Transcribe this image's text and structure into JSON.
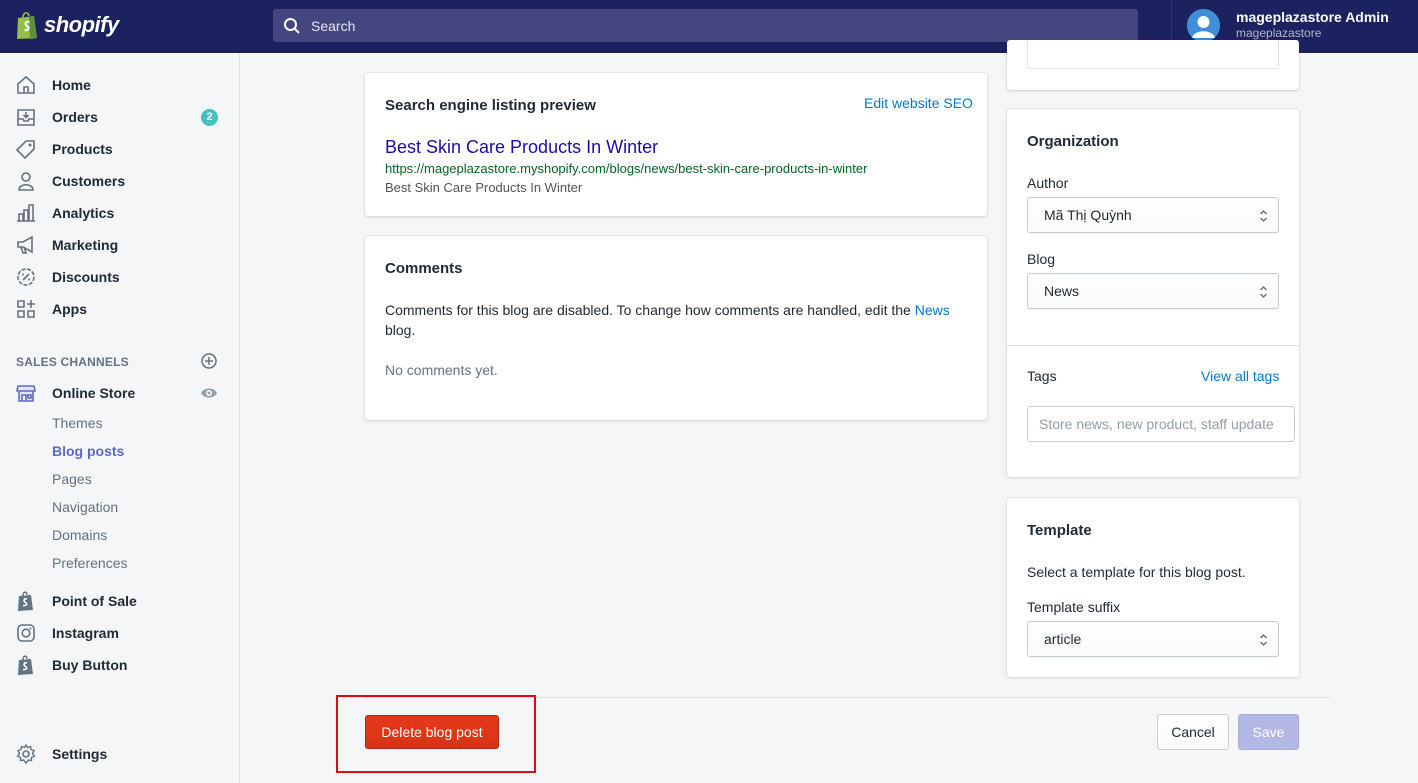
{
  "header": {
    "logo_text": "shopify",
    "search_placeholder": "Search",
    "user_name": "mageplazastore Admin",
    "user_store": "mageplazastore"
  },
  "sidebar": {
    "items": [
      {
        "label": "Home",
        "icon": "home-icon"
      },
      {
        "label": "Orders",
        "icon": "orders-icon",
        "badge": "2"
      },
      {
        "label": "Products",
        "icon": "tag-icon"
      },
      {
        "label": "Customers",
        "icon": "person-icon"
      },
      {
        "label": "Analytics",
        "icon": "bar-chart-icon"
      },
      {
        "label": "Marketing",
        "icon": "megaphone-icon"
      },
      {
        "label": "Discounts",
        "icon": "discount-icon"
      },
      {
        "label": "Apps",
        "icon": "apps-icon"
      }
    ],
    "sales_channels_title": "SALES CHANNELS",
    "online_store": "Online Store",
    "online_store_sub": [
      "Themes",
      "Blog posts",
      "Pages",
      "Navigation",
      "Domains",
      "Preferences"
    ],
    "active_sub": "Blog posts",
    "channels": [
      {
        "label": "Point of Sale",
        "icon": "shopify-bag-icon"
      },
      {
        "label": "Instagram",
        "icon": "instagram-icon"
      },
      {
        "label": "Buy Button",
        "icon": "shopify-bag-icon"
      }
    ],
    "settings": "Settings"
  },
  "seo_card": {
    "title": "Search engine listing preview",
    "edit_link": "Edit website SEO",
    "preview_title": "Best Skin Care Products In Winter",
    "preview_url": "https://mageplazastore.myshopify.com/blogs/news/best-skin-care-products-in-winter",
    "preview_description": "Best Skin Care Products In Winter"
  },
  "comments_card": {
    "title": "Comments",
    "text_before": "Comments for this blog are disabled. To change how comments are handled, edit the",
    "link": "News",
    "text_after": "blog.",
    "empty": "No comments yet."
  },
  "organization": {
    "title": "Organization",
    "author_label": "Author",
    "author_value": "Mã Thị Quỳnh",
    "blog_label": "Blog",
    "blog_value": "News",
    "tags_label": "Tags",
    "view_all_tags": "View all tags",
    "tags_placeholder": "Store news, new product, staff update"
  },
  "template_card": {
    "title": "Template",
    "description": "Select a template for this blog post.",
    "suffix_label": "Template suffix",
    "suffix_value": "article"
  },
  "footer": {
    "delete_label": "Delete blog post",
    "cancel_label": "Cancel",
    "save_label": "Save"
  },
  "colors": {
    "topbar": "#1c2260",
    "accent": "#5c6ac4",
    "link": "#007ace",
    "danger": "#de3618",
    "highlight": "#e30613"
  }
}
